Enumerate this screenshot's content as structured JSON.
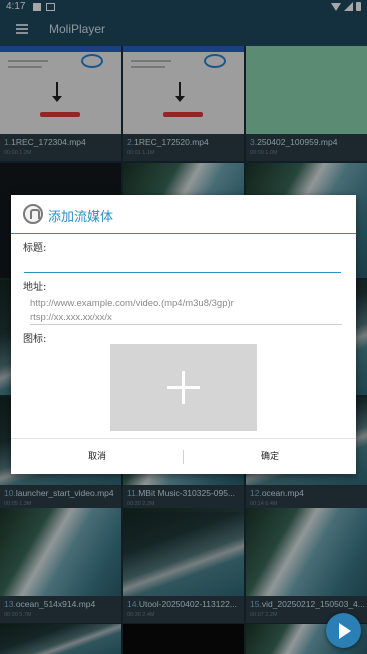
{
  "status": {
    "time": "4:17"
  },
  "app": {
    "title": "MoliPlayer"
  },
  "videos": [
    {
      "index": "1.",
      "name": "1REC_172304.mp4",
      "info": "00:00  1.2M"
    },
    {
      "index": "2.",
      "name": "1REC_172520.mp4",
      "info": "00:01  1.1M"
    },
    {
      "index": "3.",
      "name": "250402_100959.mp4",
      "info": "00:00  1.0M"
    },
    {
      "index": "10.",
      "name": "launcher_start_video.mp4",
      "info": "00:05  1.3M"
    },
    {
      "index": "11.",
      "name": "MBit Music-310325-095...",
      "info": "00:30  2.2M"
    },
    {
      "index": "12.",
      "name": "ocean.mp4",
      "info": "00:14  6.4M"
    },
    {
      "index": "13.",
      "name": "ocean_514x914.mp4",
      "info": "00:30  5.7M"
    },
    {
      "index": "14.",
      "name": "Utool-20250402-113122...",
      "info": "00:30  2.4M"
    },
    {
      "index": "15.",
      "name": "vid_20250212_150503_4...",
      "info": "00:07  2.2M"
    }
  ],
  "dialog": {
    "title": "添加流媒体",
    "title_label": "标题:",
    "title_value": "",
    "address_label": "地址:",
    "address_placeholder_line1": "http://www.example.com/video.(mp4/m3u8/3gp)r",
    "address_placeholder_line2": "rtsp://xx.xxx.xx/xx/x",
    "icon_label": "图标:",
    "cancel_label": "取消",
    "confirm_label": "确定"
  }
}
